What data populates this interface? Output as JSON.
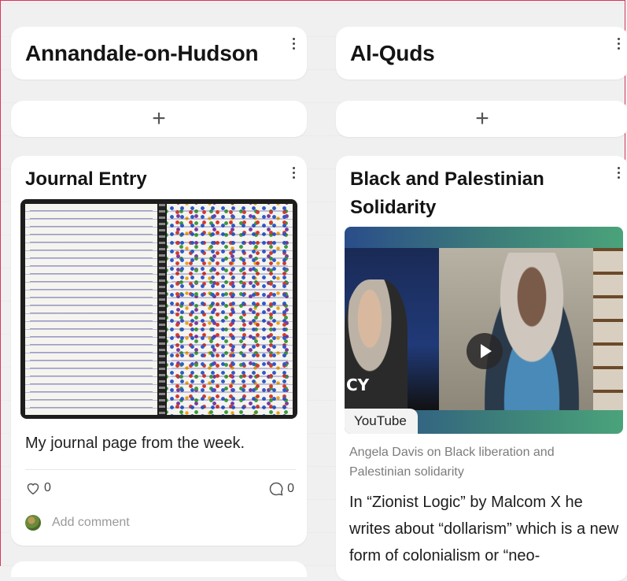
{
  "columns": [
    {
      "title": "Annandale-on-Hudson",
      "add_label": "+"
    },
    {
      "title": "Al-Quds",
      "add_label": "+"
    }
  ],
  "journal_post": {
    "title": "Journal Entry",
    "caption": "My journal page from the week.",
    "likes": "0",
    "comments": "0",
    "add_comment_placeholder": "Add comment"
  },
  "video_post": {
    "title": "Black and Palestinian Solidarity",
    "source_badge": "YouTube",
    "overlay_text": "CY",
    "link_description": "Angela Davis on Black liberation and Palestinian solidarity",
    "body": "In “Zionist Logic” by Malcom X he writes about “dollarism” which is a new form of colonialism or “neo-"
  },
  "colors": {
    "frame_border": "#d9365b",
    "card_background": "#ffffff",
    "board_background": "#f0f0f0"
  },
  "icons": [
    "kebab-menu-icon",
    "plus-icon",
    "heart-icon",
    "comment-bubble-icon",
    "play-icon",
    "avatar"
  ]
}
